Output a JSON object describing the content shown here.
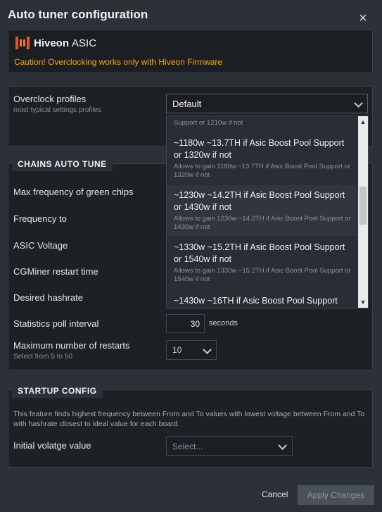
{
  "dialog": {
    "title": "Auto tuner configuration"
  },
  "brand": {
    "name": "Hiveon",
    "sub": "ASIC",
    "caution": "Caution! Overclocking works only with Hiveon Firmware"
  },
  "overclock": {
    "label": "Overclock profiles",
    "sublabel": "most typical settings profiles",
    "selected": "Default",
    "options": [
      {
        "title": "Support or 1210w if not",
        "desc": ""
      },
      {
        "title": "~1180w ~13.7TH if Asic Boost Pool Support or 1320w if not",
        "desc": "Allows to gain 1180w ~13.7TH if Asic Boost Pool Support or 1320w if not"
      },
      {
        "title": "~1230w ~14.2TH if Asic Boost Pool Support or 1430w if not",
        "desc": "Allows to gain 1230w ~14.2TH if Asic Boost Pool Support or 1430w if not"
      },
      {
        "title": "~1330w ~15.2TH if Asic Boost Pool Support or 1540w if not",
        "desc": "Allows to gain 1330w ~15.2TH if Asic Boost Pool Support or 1540w if not"
      },
      {
        "title": "~1430w ~16TH if Asic Boost Pool Support",
        "desc": ""
      }
    ]
  },
  "chains": {
    "section": "CHAINS AUTO TUNE",
    "labels": [
      "Max frequency of green chips",
      "Frequency to",
      "ASIC Voltage",
      "CGMiner restart time",
      "Desired hashrate"
    ],
    "poll_label": "Statistics poll interval",
    "poll_value": "30",
    "poll_unit": "seconds",
    "restarts_label": "Maximum number of restarts",
    "restarts_sub": "Select from 5 to 50",
    "restarts_value": "10"
  },
  "startup": {
    "section": "STARTUP CONFIG",
    "desc": "This feature finds highest frequency between From and To values with lowest voltage between From and To with hashrate closest to ideal value for each board.",
    "init_label": "Initial volatge value",
    "init_placeholder": "Select..."
  },
  "footer": {
    "cancel": "Cancel",
    "apply": "Apply Changes"
  }
}
